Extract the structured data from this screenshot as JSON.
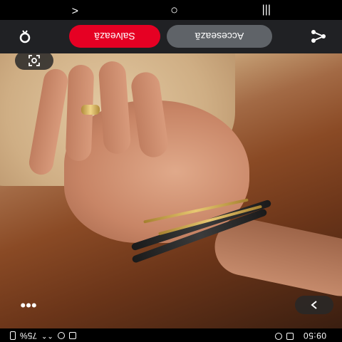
{
  "status_bar": {
    "time": "09:50",
    "battery": "75%"
  },
  "actions": {
    "visit_label": "Accesează",
    "save_label": "Salvează"
  },
  "photo": {
    "alt_icon": "image-photo"
  },
  "icons": {
    "share": "share-icon",
    "pin": "pin-icon",
    "lens": "visual-search-icon",
    "more": "more-dots-icon",
    "next": "chevron-right-icon"
  },
  "colors": {
    "save": "#e60023",
    "visit": "#5f6368",
    "bar": "#202124"
  },
  "nav": {
    "recents": "|||",
    "home": "○",
    "back": "<"
  }
}
